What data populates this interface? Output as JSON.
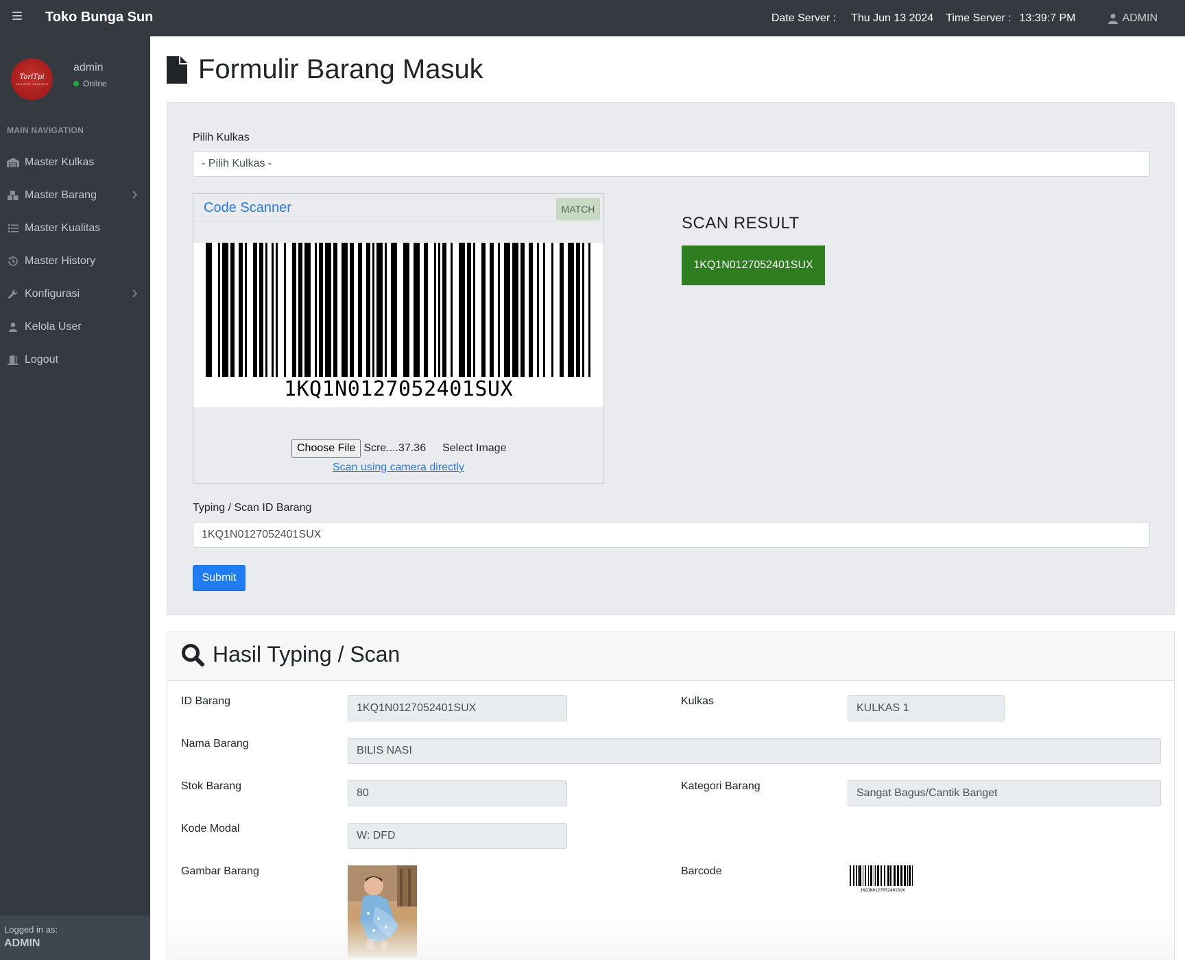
{
  "app": {
    "brand": "Toko Bunga Sun"
  },
  "server": {
    "date_label": "Date Server :",
    "date_value": "Thu Jun 13 2024",
    "time_label": "Time Server :",
    "time_value": "13:39:7 PM"
  },
  "user_menu": {
    "label": "ADMIN",
    "icon": "user-icon"
  },
  "sidebar": {
    "user_name": "admin",
    "user_status": "Online",
    "logo_text": "ToriTpi",
    "logo_sub": "ARCHERY SEAFOOD",
    "nav_header": "MAIN NAVIGATION",
    "items": [
      {
        "label": "Master Kulkas",
        "icon": "warehouse-icon",
        "has_submenu": false
      },
      {
        "label": "Master Barang",
        "icon": "boxes-icon",
        "has_submenu": true
      },
      {
        "label": "Master Kualitas",
        "icon": "list-icon",
        "has_submenu": false
      },
      {
        "label": "Master History",
        "icon": "history-icon",
        "has_submenu": false
      },
      {
        "label": "Konfigurasi",
        "icon": "wrench-icon",
        "has_submenu": true
      },
      {
        "label": "Kelola User",
        "icon": "user-icon",
        "has_submenu": false
      },
      {
        "label": "Logout",
        "icon": "logout-icon",
        "has_submenu": false
      }
    ],
    "logged_in_label": "Logged in as:",
    "logged_in_user": "ADMIN"
  },
  "page": {
    "title": "Formulir Barang Masuk",
    "icon": "file-icon"
  },
  "form": {
    "kulkas_label": "Pilih Kulkas",
    "kulkas_selected": "- Pilih Kulkas -",
    "scanner": {
      "title": "Code Scanner",
      "status_badge": "MATCH",
      "barcode_text": "1KQ1N0127052401SUX",
      "choose_file_label": "Choose File",
      "file_name": "Scre....37.36",
      "select_image_label": "Select Image",
      "camera_link": "Scan using camera directly"
    },
    "scan_result_title": "SCAN RESULT",
    "scan_result_value": "1KQ1N0127052401SUX",
    "id_label": "Typing / Scan ID Barang",
    "id_value": "1KQ1N0127052401SUX",
    "submit_label": "Submit"
  },
  "result": {
    "title": "Hasil Typing / Scan",
    "icon": "search-icon",
    "fields": {
      "id_barang_label": "ID Barang",
      "id_barang_value": "1KQ1N0127052401SUX",
      "kulkas_label": "Kulkas",
      "kulkas_value": "KULKAS 1",
      "nama_label": "Nama Barang",
      "nama_value": "BILIS NASI",
      "stok_label": "Stok Barang",
      "stok_value": "80",
      "kategori_label": "Kategori Barang",
      "kategori_value": "Sangat Bagus/Cantik Banget",
      "kode_label": "Kode Modal",
      "kode_value": "W: DFD",
      "gambar_label": "Gambar Barang",
      "barcode_label": "Barcode",
      "barcode_caption": "1KQ1N0127052401SUX"
    }
  },
  "colors": {
    "navbar": "#343a40",
    "sidebar": "#343a40",
    "primary": "#1f7cf2",
    "scan_result": "#2e7d1f",
    "online": "#28a745"
  }
}
